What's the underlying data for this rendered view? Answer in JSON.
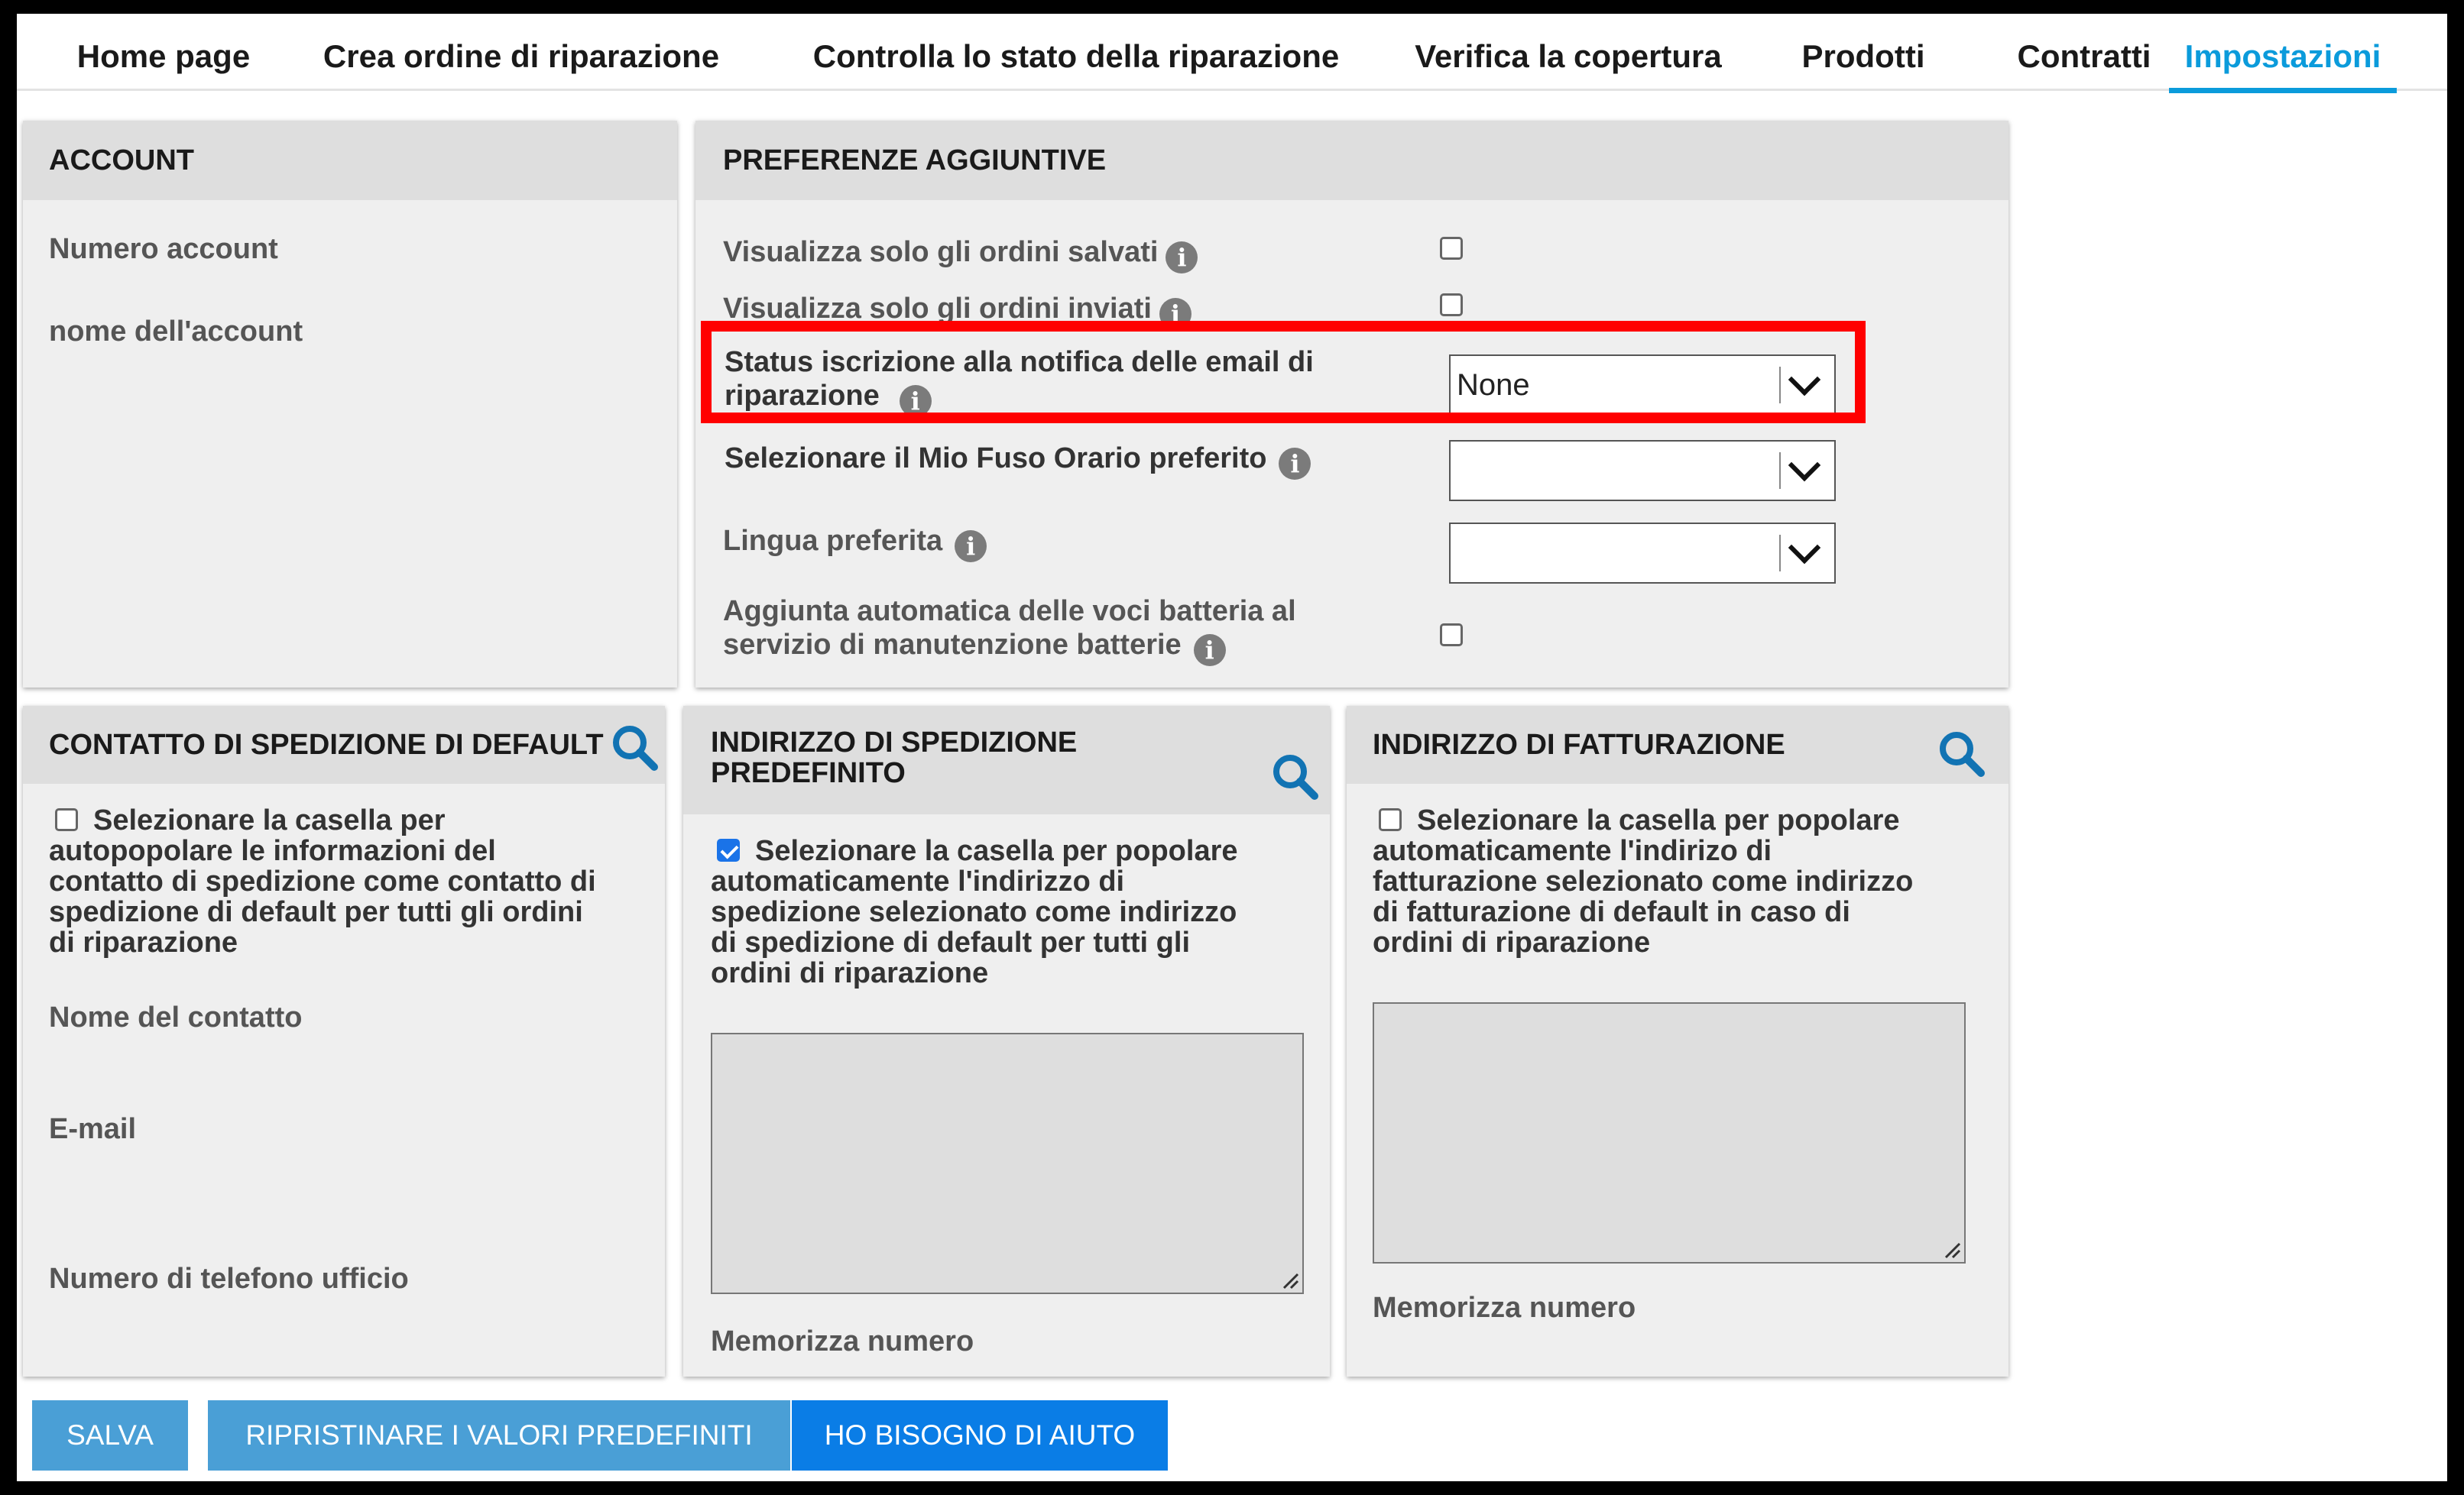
{
  "nav": {
    "tabs": [
      {
        "label": "Home page"
      },
      {
        "label": "Crea ordine di riparazione"
      },
      {
        "label": "Controlla lo stato della riparazione"
      },
      {
        "label": "Verifica la copertura"
      },
      {
        "label": "Prodotti"
      },
      {
        "label": "Contratti"
      },
      {
        "label": "Impostazioni",
        "active": true
      }
    ]
  },
  "account": {
    "title": "ACCOUNT",
    "number_label": "Numero account",
    "name_label": "nome dell'account"
  },
  "preferences": {
    "title": "PREFERENZE AGGIUNTIVE",
    "saved_orders_label": "Visualizza solo gli ordini salvati",
    "sent_orders_label": "Visualizza solo gli ordini inviati",
    "email_status_label_1": "Status iscrizione alla notifica delle email di",
    "email_status_label_2": "riparazione",
    "email_status_value": "None",
    "timezone_label": "Selezionare il Mio Fuso Orario preferito",
    "timezone_value": "",
    "language_label": "Lingua preferita",
    "language_value": "",
    "battery_label_1": "Aggiunta automatica delle voci batteria al",
    "battery_label_2": "servizio di manutenzione batterie"
  },
  "shipping_contact": {
    "title": "CONTATTO DI SPEDIZIONE DI DEFAULT",
    "checkbox_text": [
      "Selezionare la casella per",
      "autopopolare le informazioni del",
      "contatto di spedizione come contatto di",
      "spedizione di default per tutti gli ordini",
      "di riparazione"
    ],
    "contact_name_label": "Nome del contatto",
    "email_label": "E-mail",
    "phone_label": "Numero di telefono ufficio"
  },
  "shipping_address": {
    "title_1": "INDIRIZZO DI SPEDIZIONE",
    "title_2": "PREDEFINITO",
    "checkbox_text": [
      "Selezionare la casella per popolare",
      "automaticamente l'indirizzo di",
      "spedizione selezionato come indirizzo",
      "di spedizione di default per tutti gli",
      "ordini di riparazione"
    ],
    "store_number_label": "Memorizza numero"
  },
  "billing_address": {
    "title": "INDIRIZZO DI FATTURAZIONE",
    "checkbox_text": [
      "Selezionare la casella per popolare",
      "automaticamente l'indirizo di",
      "fatturazione selezionato come indirizzo",
      "di fatturazione di default in caso di",
      "ordini di riparazione"
    ],
    "store_number_label": "Memorizza numero"
  },
  "buttons": {
    "save": "SALVA",
    "reset": "RIPRISTINARE I VALORI PREDEFINITI",
    "help": "HO BISOGNO DI AIUTO"
  },
  "colors": {
    "accent": "#0b9bdb",
    "button_light": "#4a9fd6",
    "button_help": "#0a7de6",
    "highlight": "#ff0000"
  },
  "icons": {
    "info": "info-icon",
    "search": "search-icon",
    "dropdown": "chevron-down-icon"
  }
}
